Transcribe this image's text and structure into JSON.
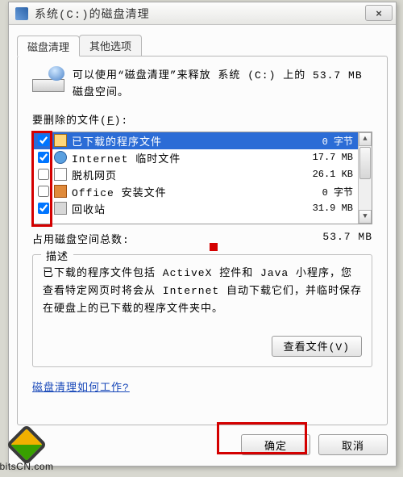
{
  "titlebar": {
    "title": "系统(C:)的磁盘清理",
    "close": "×"
  },
  "tabs": {
    "cleanup": "磁盘清理",
    "other": "其他选项"
  },
  "intro": "可以使用“磁盘清理”来释放 系统 (C:) 上的 53.7 MB 磁盘空间。",
  "list_label_prefix": "要删除的文件(",
  "list_label_key": "F",
  "list_label_suffix": "):",
  "files": [
    {
      "checked": true,
      "icon": "folder",
      "name": "已下载的程序文件",
      "size": "0 字节"
    },
    {
      "checked": true,
      "icon": "ie",
      "name": "Internet 临时文件",
      "size": "17.7 MB"
    },
    {
      "checked": false,
      "icon": "page",
      "name": "脱机网页",
      "size": "26.1 KB"
    },
    {
      "checked": false,
      "icon": "office",
      "name": "Office 安装文件",
      "size": "0 字节"
    },
    {
      "checked": true,
      "icon": "recycle",
      "name": "回收站",
      "size": "31.9 MB"
    }
  ],
  "space": {
    "label": "占用磁盘空间总数:",
    "value": "53.7 MB"
  },
  "group": {
    "legend": "描述",
    "desc": "已下载的程序文件包括 ActiveX 控件和 Java 小程序，您查看特定网页时将会从 Internet 自动下载它们，并临时保存在硬盘上的已下载的程序文件夹中。",
    "viewfiles": "查看文件(V)"
  },
  "link": "磁盘清理如何工作?",
  "buttons": {
    "ok": "确定",
    "cancel": "取消"
  },
  "logo": "bitsCN.com"
}
